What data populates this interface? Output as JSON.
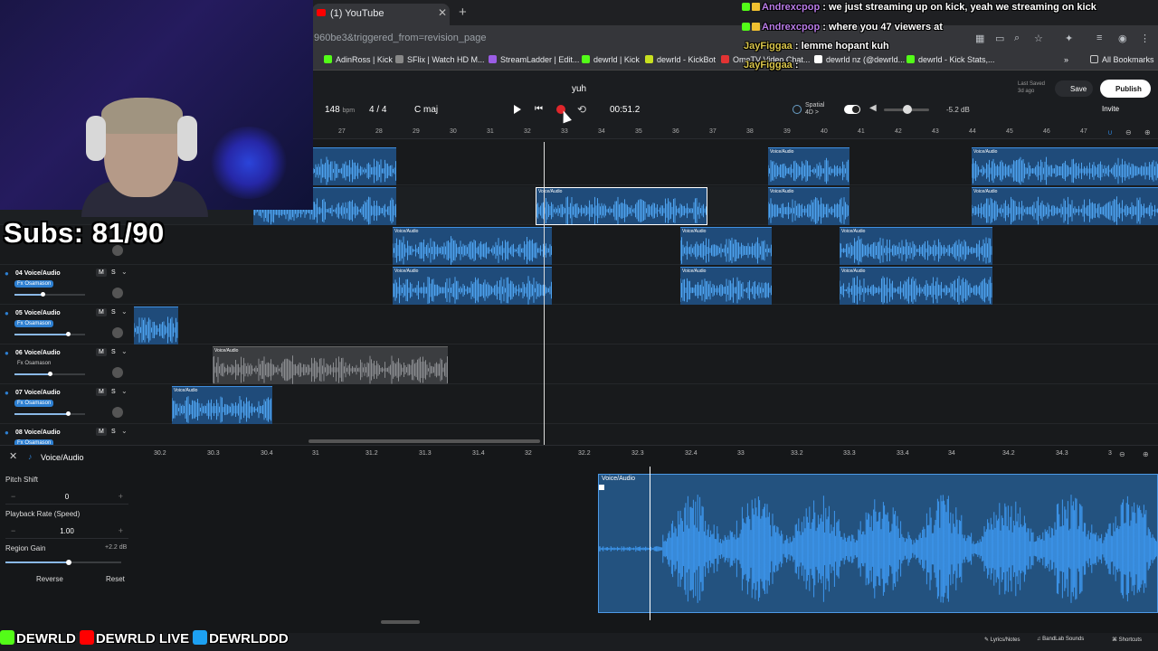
{
  "browser": {
    "tab_title": "(1) YouTube",
    "url": "960be3&triggered_from=revision_page",
    "bookmarks": [
      {
        "label": "AdinRoss | Kick",
        "color": "#53fc18"
      },
      {
        "label": "SFlix | Watch HD M...",
        "color": "#888888"
      },
      {
        "label": "StreamLadder | Edit...",
        "color": "#9b5de5"
      },
      {
        "label": "dewrld | Kick",
        "color": "#53fc18"
      },
      {
        "label": "dewrld - KickBot",
        "color": "#c8e020"
      },
      {
        "label": "OmeTV Video Chat...",
        "color": "#e23333"
      },
      {
        "label": "dewrld nz (@dewrld...",
        "color": "#ffffff"
      },
      {
        "label": "dewrld - Kick Stats,...",
        "color": "#53fc18"
      }
    ],
    "all_bookmarks": "All Bookmarks"
  },
  "daw": {
    "project_name": "yuh",
    "bpm_value": "148",
    "bpm_unit": "bpm",
    "time_signature": "4 / 4",
    "key": "C maj",
    "time": "00:51.2",
    "spatial_label": "Spatial",
    "spatial_sub": "4D >",
    "volume_db": "-5.2 dB",
    "last_saved_label": "Last Saved",
    "last_saved_value": "3d ago",
    "save_label": "Save",
    "publish_label": "Publish",
    "invite_label": "Invite",
    "ruler": [
      "27",
      "28",
      "29",
      "30",
      "31",
      "32",
      "33",
      "34",
      "35",
      "36",
      "37",
      "38",
      "39",
      "40",
      "41",
      "42",
      "43",
      "44",
      "45",
      "46",
      "47"
    ],
    "clip_label": "Voice/Audio"
  },
  "tracks": [
    {
      "name": "04 Voice/Audio",
      "fx": "Fx Osamason",
      "m": "M",
      "s": "S",
      "volume": 0.4
    },
    {
      "name": "05 Voice/Audio",
      "fx": "Fx Osamason",
      "m": "M",
      "s": "S",
      "volume": 0.75
    },
    {
      "name": "06 Voice/Audio",
      "fx": "Fx Osamason",
      "m": "M",
      "s": "S",
      "volume": 0.5
    },
    {
      "name": "07 Voice/Audio",
      "fx": "Fx Osamason",
      "m": "M",
      "s": "S",
      "volume": 0.75
    },
    {
      "name": "08 Voice/Audio",
      "fx": "Fx Osamason",
      "m": "M",
      "s": "S",
      "volume": 0.5
    }
  ],
  "editor": {
    "title": "Voice/Audio",
    "ruler": [
      "30.2",
      "30.3",
      "30.4",
      "31",
      "31.2",
      "31.3",
      "31.4",
      "32",
      "32.2",
      "32.3",
      "32.4",
      "33",
      "33.2",
      "33.3",
      "33.4",
      "34",
      "34.2",
      "34.3",
      "3"
    ],
    "pitch_shift_label": "Pitch Shift",
    "pitch_shift_value": "0",
    "playback_rate_label": "Playback Rate (Speed)",
    "playback_rate_value": "1.00",
    "region_gain_label": "Region Gain",
    "region_gain_value": "+2.2 dB",
    "region_gain_level": 0.55,
    "reverse_label": "Reverse",
    "reset_label": "Reset",
    "clip_label": "Voice/Audio"
  },
  "footer": {
    "lyrics": "Lyrics/Notes",
    "sounds": "BandLab Sounds",
    "shortcuts": "Shortcuts"
  },
  "overlay": {
    "subs": "Subs: 81/90",
    "chat": [
      {
        "user": "Andrexcpop",
        "msg": " : we just streaming up on kick, yeah we streaming on kick"
      },
      {
        "user": "Andrexcpop",
        "msg": " : where you 47 viewers at"
      },
      {
        "user": "JayFiggaa",
        "msg": " : lemme hopant kuh"
      },
      {
        "user": "JayFiggaa",
        "msg": " :"
      }
    ],
    "socials": [
      "DEWRLD",
      "DEWRLD LIVE",
      "DEWRLDDD"
    ]
  }
}
